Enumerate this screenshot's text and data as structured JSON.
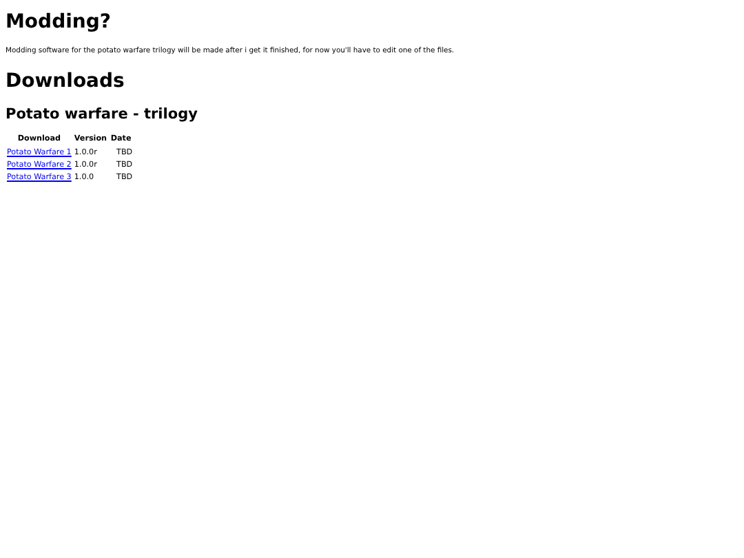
{
  "modding": {
    "heading": "Modding?",
    "text": "Modding software for the potato warfare trilogy will be made after i get it finished, for now you'll have to edit one of the files."
  },
  "downloads": {
    "heading": "Downloads",
    "subheading": "Potato warfare - trilogy",
    "table": {
      "columns": [
        "Download",
        "Version",
        "Date"
      ],
      "rows": [
        {
          "download": "Potato Warfare 1",
          "version": "1.0.0r",
          "date": "TBD"
        },
        {
          "download": "Potato Warfare 2",
          "version": "1.0.0r",
          "date": "TBD"
        },
        {
          "download": "Potato Warfare 3",
          "version": "1.0.0",
          "date": "TBD"
        }
      ]
    }
  }
}
